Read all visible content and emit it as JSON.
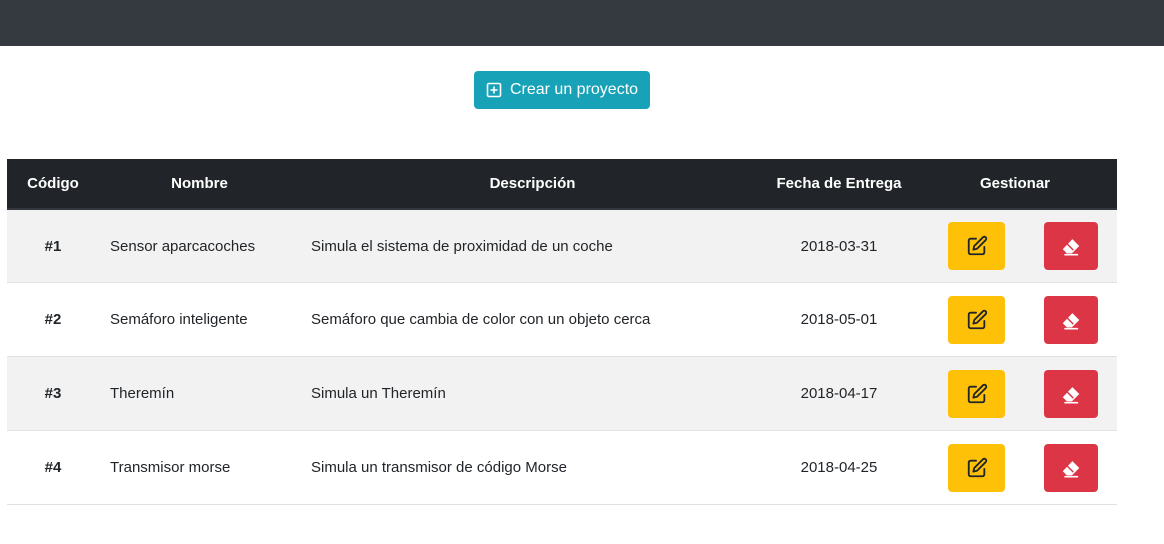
{
  "header": {
    "create_button_label": "Crear un proyecto",
    "create_icon": "plus-square-icon"
  },
  "table": {
    "columns": {
      "code": "Código",
      "name": "Nombre",
      "description": "Descripción",
      "date": "Fecha de Entrega",
      "manage": "Gestionar"
    },
    "rows": [
      {
        "code": "#1",
        "name": "Sensor aparcacoches",
        "description": "Simula el sistema de proximidad de un coche",
        "date": "2018-03-31"
      },
      {
        "code": "#2",
        "name": "Semáforo inteligente",
        "description": "Semáforo que cambia de color con un objeto cerca",
        "date": "2018-05-01"
      },
      {
        "code": "#3",
        "name": "Theremín",
        "description": "Simula un Theremín",
        "date": "2018-04-17"
      },
      {
        "code": "#4",
        "name": "Transmisor morse",
        "description": "Simula un transmisor de código Morse",
        "date": "2018-04-25"
      }
    ],
    "row_actions": {
      "edit_icon": "edit-icon",
      "delete_icon": "eraser-icon"
    }
  },
  "colors": {
    "navbar": "#343a40",
    "info": "#17a2b8",
    "warning": "#ffc107",
    "danger": "#dc3545",
    "table_header": "#212529",
    "stripe": "#f2f2f2"
  }
}
